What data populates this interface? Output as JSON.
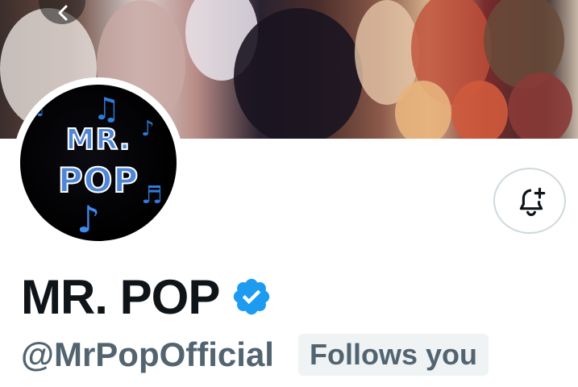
{
  "profile": {
    "display_name": "MR. POP",
    "handle": "@MrPopOfficial",
    "follows_you_badge": "Follows you",
    "verified": true
  },
  "avatar": {
    "line1": "MR.",
    "line2": "POP"
  },
  "icons": {
    "verified_badge": "verified-badge-icon",
    "notify": "bell-plus-icon",
    "back": "back-arrow-icon"
  },
  "colors": {
    "verified_blue": "#1d9bf0",
    "text_primary": "#0f1419",
    "text_secondary": "#536471",
    "badge_bg": "#eff3f4",
    "avatar_blue": "#4f86d8"
  }
}
